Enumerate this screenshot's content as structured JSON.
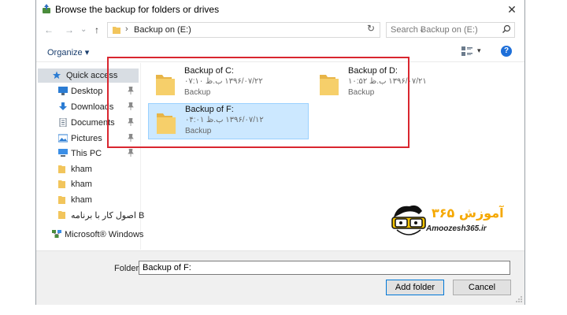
{
  "window": {
    "title": "Browse the backup for folders or drives",
    "close_glyph": "✕"
  },
  "address": {
    "path": "Backup on (E:)",
    "separator": "›",
    "search_placeholder": "Search Backup on (E:)"
  },
  "nav_glyphs": {
    "back": "←",
    "forward": "→",
    "dropdown": "⌄",
    "up": "↑",
    "refresh": "↻",
    "caret": "▾"
  },
  "toolbar": {
    "organize_label": "Organize",
    "help_label": "?"
  },
  "sidebar": {
    "items": [
      {
        "label": "Quick access",
        "icon": "star-icon",
        "pinned": false
      },
      {
        "label": "Desktop",
        "icon": "desktop-icon",
        "pinned": true
      },
      {
        "label": "Downloads",
        "icon": "downloads-icon",
        "pinned": true
      },
      {
        "label": "Documents",
        "icon": "documents-icon",
        "pinned": true
      },
      {
        "label": "Pictures",
        "icon": "pictures-icon",
        "pinned": true
      },
      {
        "label": "This PC",
        "icon": "computer-icon",
        "pinned": true
      },
      {
        "label": "kham",
        "icon": "folder-icon",
        "pinned": false
      },
      {
        "label": "kham",
        "icon": "folder-icon",
        "pinned": false
      },
      {
        "label": "kham",
        "icon": "folder-icon",
        "pinned": false
      },
      {
        "label": "B اصول کار با برنامه",
        "icon": "folder-icon",
        "pinned": false
      },
      {
        "label": "Microsoft® Windows",
        "icon": "network-icon",
        "pinned": false
      }
    ]
  },
  "files": [
    {
      "name": "Backup of C:",
      "date": "۱۳۹۶/۰۷/۲۲ ب.ظ ۰۷:۱۰",
      "type": "Backup"
    },
    {
      "name": "Backup of D:",
      "date": "۱۳۹۶/۰۷/۲۱ ب.ظ ۱۰:۵۲",
      "type": "Backup"
    },
    {
      "name": "Backup of F:",
      "date": "۱۳۹۶/۰۷/۱۲ ب.ظ ۰۴:۰۱",
      "type": "Backup"
    }
  ],
  "footer": {
    "folder_label": "Folder:",
    "folder_value": "Backup of F:",
    "add_button": "Add folder",
    "cancel_button": "Cancel"
  },
  "logo": {
    "text": "آموزش ۳۶۵",
    "site": "Amoozesh365.ir"
  },
  "colors": {
    "accent": "#0078d7",
    "highlight_red": "#d9262f",
    "selection_bg": "#cce8ff",
    "folder": "#f2c55c"
  }
}
